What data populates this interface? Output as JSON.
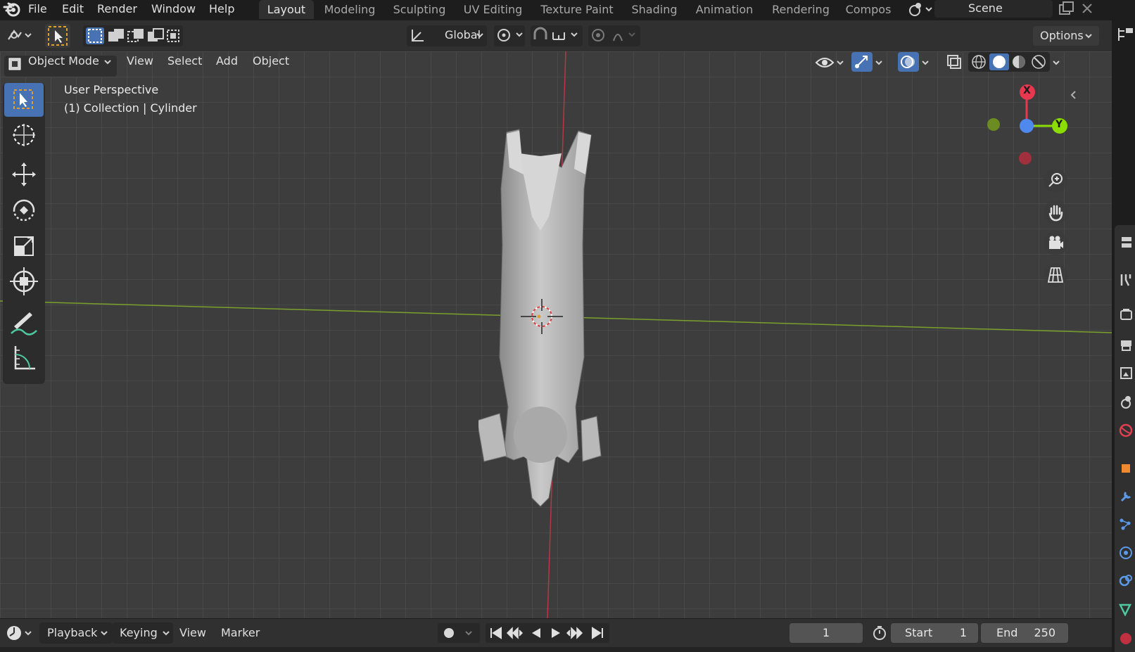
{
  "menu": {
    "items": [
      "File",
      "Edit",
      "Render",
      "Window",
      "Help"
    ]
  },
  "workspaces": {
    "tabs": [
      "Layout",
      "Modeling",
      "Sculpting",
      "UV Editing",
      "Texture Paint",
      "Shading",
      "Animation",
      "Rendering",
      "Compos"
    ],
    "active": "Layout"
  },
  "scene": {
    "name": "Scene"
  },
  "toolheader": {
    "transform_orientation": "Global",
    "options_label": "Options"
  },
  "viewport_header": {
    "mode": "Object Mode",
    "menus": [
      "View",
      "Select",
      "Add",
      "Object"
    ]
  },
  "viewport": {
    "view_name": "User Perspective",
    "collection_info": "(1) Collection | Cylinder",
    "gizmo": {
      "x_label": "X",
      "y_label": "Y"
    }
  },
  "timeline": {
    "menus": [
      "Playback",
      "Keying",
      "View",
      "Marker"
    ],
    "current_frame": "1",
    "start_label": "Start",
    "start_value": "1",
    "end_label": "End",
    "end_value": "250"
  },
  "colors": {
    "accent": "#4772b3",
    "x_axis": "#e8384f",
    "y_axis": "#8bdc00",
    "z_axis": "#4f88ee",
    "viewport_bg": "#3d3d3d"
  }
}
